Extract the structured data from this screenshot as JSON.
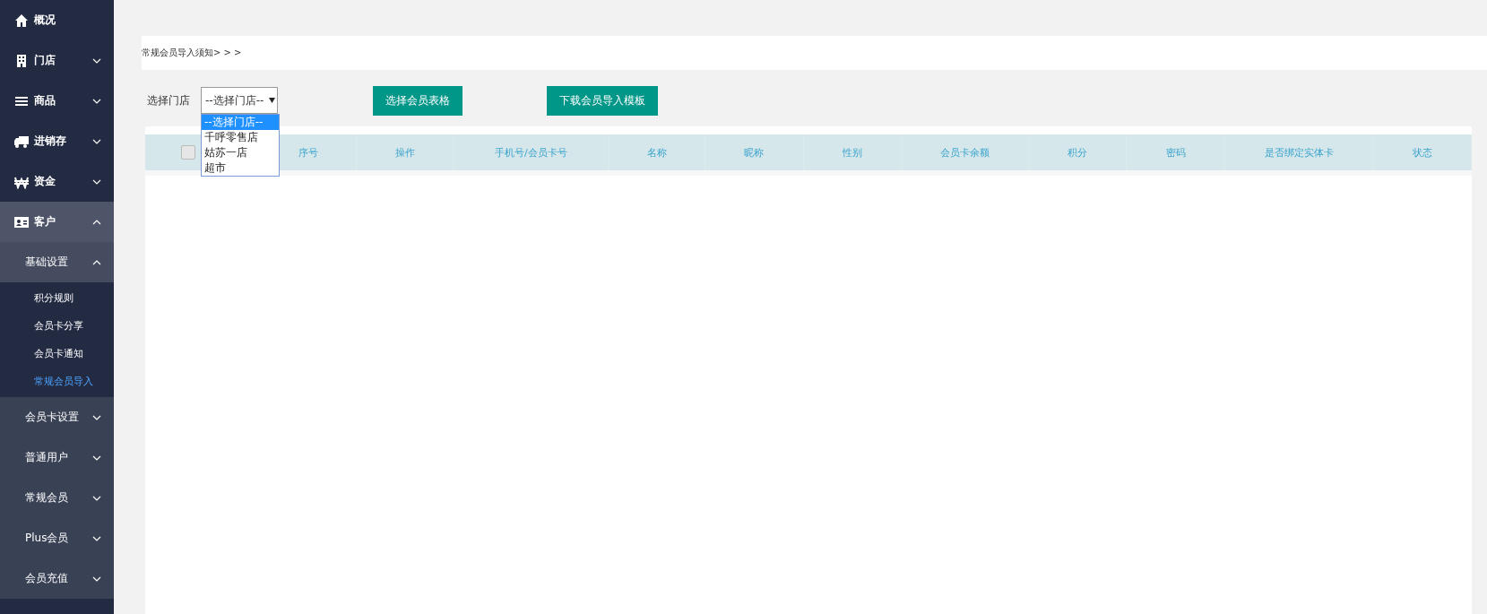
{
  "sidebar": {
    "items": [
      {
        "label": "概况",
        "kind": "link"
      },
      {
        "label": "门店",
        "kind": "menu",
        "expanded": false
      },
      {
        "label": "商品",
        "kind": "menu",
        "expanded": false
      },
      {
        "label": "进销存",
        "kind": "menu",
        "expanded": false
      },
      {
        "label": "资金",
        "kind": "menu",
        "expanded": false
      },
      {
        "label": "客户",
        "kind": "menu",
        "expanded": true,
        "children": [
          {
            "label": "基础设置",
            "expanded": true,
            "children": [
              {
                "label": "积分规则",
                "selected": false
              },
              {
                "label": "会员卡分享",
                "selected": false
              },
              {
                "label": "会员卡通知",
                "selected": false
              },
              {
                "label": "常规会员导入",
                "selected": true
              }
            ]
          },
          {
            "label": "会员卡设置",
            "expanded": false
          },
          {
            "label": "普通用户",
            "expanded": false
          },
          {
            "label": "常规会员",
            "expanded": false
          },
          {
            "label": "Plus会员",
            "expanded": false
          },
          {
            "label": "会员充值",
            "expanded": false
          }
        ]
      }
    ]
  },
  "notice": "常规会员导入须知> > >",
  "toolbar": {
    "store_label": "选择门店",
    "store_select": {
      "value": "--选择门店--",
      "expanded": true,
      "options": [
        {
          "label": "--选择门店--",
          "selected": true
        },
        {
          "label": "千呼零售店",
          "selected": false
        },
        {
          "label": "姑苏一店",
          "selected": false
        },
        {
          "label": "超市",
          "selected": false
        }
      ]
    },
    "buttons": [
      "选择会员表格",
      "下载会员导入模板"
    ]
  },
  "table": {
    "select_all_checked": false,
    "columns": [
      "序号",
      "操作",
      "手机号/会员卡号",
      "名称",
      "昵称",
      "性别",
      "会员卡余额",
      "积分",
      "密码",
      "是否绑定实体卡",
      "状态"
    ]
  }
}
